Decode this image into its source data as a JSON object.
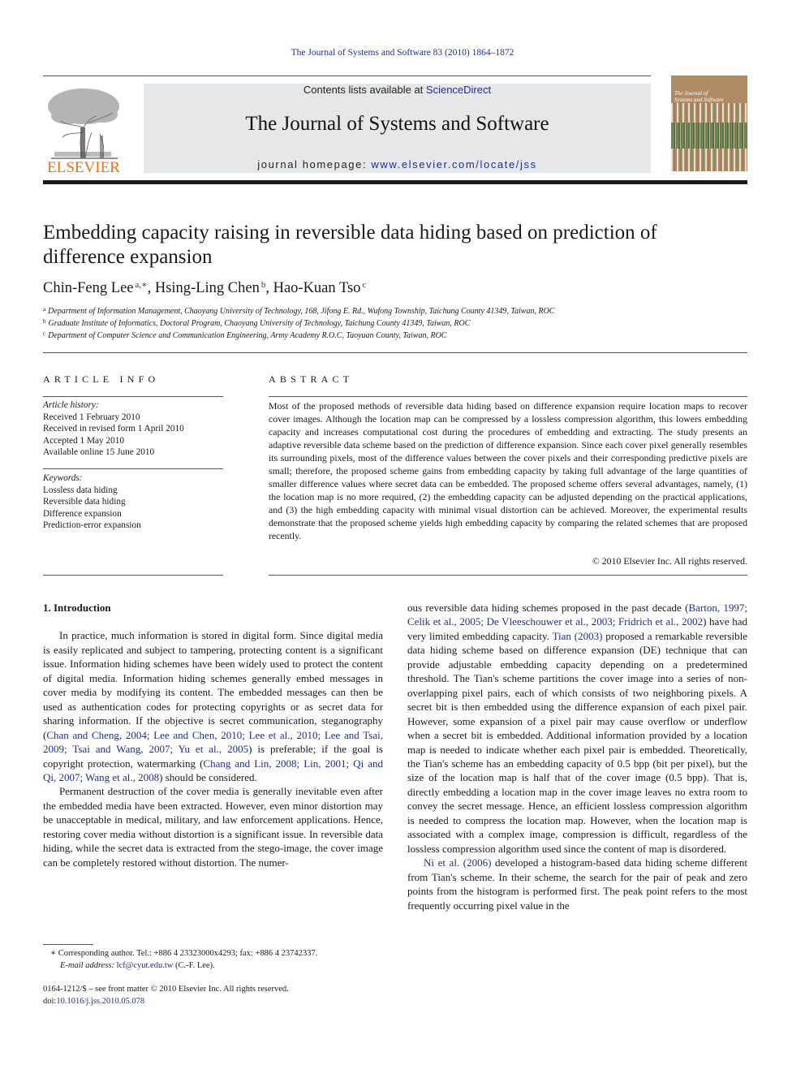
{
  "running_head": "The Journal of Systems and Software 83 (2010) 1864–1872",
  "publisher": {
    "name": "ELSEVIER",
    "brand_color": "#e9711c"
  },
  "masthead": {
    "contents_prefix": "Contents lists available at ",
    "contents_link": "ScienceDirect",
    "journal_title": "The Journal of Systems and Software",
    "homepage_prefix": "journal homepage: ",
    "homepage_link": "www.elsevier.com/locate/jss",
    "link_color": "#1f2f8f",
    "background": "#e6e7e8"
  },
  "cover": {
    "title_line1": "The Journal of",
    "title_line2": "Systems and Software"
  },
  "article": {
    "title": "Embedding capacity raising in reversible data hiding based on prediction of difference expansion",
    "authors": [
      {
        "name": "Chin-Feng Lee",
        "sup": "a,∗"
      },
      {
        "name": "Hsing-Ling Chen",
        "sup": "b"
      },
      {
        "name": "Hao-Kuan Tso",
        "sup": "c"
      }
    ],
    "affiliations": [
      {
        "mark": "a",
        "text": "Department of Information Management, Chaoyang University of Technology, 168, Jifong E. Rd., Wufong Township, Taichung County 41349, Taiwan, ROC"
      },
      {
        "mark": "b",
        "text": "Graduate Institute of Informatics, Doctoral Program, Chaoyang University of Technology, Taichung County 41349, Taiwan, ROC"
      },
      {
        "mark": "c",
        "text": "Department of Computer Science and Communication Engineering, Army Academy R.O.C, Taoyuan County, Taiwan, ROC"
      }
    ]
  },
  "article_info": {
    "heading": "ARTICLE INFO",
    "history_label": "Article history:",
    "history": [
      "Received 1 February 2010",
      "Received in revised form 1 April 2010",
      "Accepted 1 May 2010",
      "Available online 15 June 2010"
    ],
    "keywords_label": "Keywords:",
    "keywords": [
      "Lossless data hiding",
      "Reversible data hiding",
      "Difference expansion",
      "Prediction-error expansion"
    ]
  },
  "abstract": {
    "heading": "ABSTRACT",
    "text": "Most of the proposed methods of reversible data hiding based on difference expansion require location maps to recover cover images. Although the location map can be compressed by a lossless compression algorithm, this lowers embedding capacity and increases computational cost during the procedures of embedding and extracting. The study presents an adaptive reversible data scheme based on the pre­diction of difference expansion. Since each cover pixel generally resembles its surrounding pixels, most of the difference values between the cover pixels and their corresponding predictive pixels are small; therefore, the proposed scheme gains from embedding capacity by taking full advantage of the large quantities of smaller difference values where secret data can be embedded. The proposed scheme offers several advantages, namely, (1) the location map is no more required, (2) the embedding capacity can be adjusted depending on the practical applications, and (3) the high embedding capacity with minimal visual distortion can be achieved. Moreover, the experimental results demonstrate that the proposed scheme yields high embedding capacity by comparing the related schemes that are proposed recently.",
    "copyright": "© 2010 Elsevier Inc. All rights reserved."
  },
  "body": {
    "section_heading": "1.  Introduction",
    "p1_a": "In practice, much information is stored in digital form. Since digital media is easily replicated and subject to tampering, protect­ing content is a significant issue. Information hiding schemes have been widely used to protect the content of digital media. Informa­tion hiding schemes generally embed messages in cover media by modifying its content. The embedded messages can then be used as authentication codes for protecting copyrights or as secret data for sharing information. If the objective is secret communication, steganography (",
    "p1_cite1": "Chan and Cheng, 2004; Lee and Chen, 2010; Lee et al., 2010; Lee and Tsai, 2009; Tsai and Wang, 2007; Yu et al., 2005",
    "p1_b": ") is preferable; if the goal is copyright protection, watermarking (",
    "p1_cite2": "Chang and Lin, 2008; Lin, 2001; Qi and Qi, 2007; Wang et al., 2008",
    "p1_c": ") should be considered.",
    "p2": "Permanent destruction of the cover media is generally inevitable even after the embedded media have been extracted. However, even minor distortion may be unacceptable in medical, military, and law enforcement applications. Hence, restoring cover media without distortion is a significant issue. In reversible data hiding, while the secret data is extracted from the stego-image, the cover image can be completely restored without distortion. The numer­ous reversible data hiding schemes proposed in the past decade (",
    "p2_cite1": "Barton, 1997; Celik et al., 2005; De Vleeschouwer et al., 2003; Fridrich et al., 2002",
    "p2_b": ") have had very limited embedding capacity. ",
    "p2_cite2": "Tian (2003)",
    "p2_c": " proposed a remarkable reversible data hiding scheme based on difference expansion (DE) technique that can provide adjustable embedding capacity depending on a predetermined threshold. The Tian's scheme partitions the cover image into a series of non-overlapping pixel pairs, each of which consists of two neigh­boring pixels. A secret bit is then embedded using the difference expansion of each pixel pair. However, some expansion of a pixel pair may cause overflow or underflow when a secret bit is embed­ded. Additional information provided by a location map is needed to indicate whether each pixel pair is embedded. Theoretically, the Tian's scheme has an embedding capacity of 0.5 bpp (bit per pixel), but the size of the location map is half that of the cover image (0.5 bpp). That is, directly embedding a location map in the cover image leaves no extra room to convey the secret message. Hence, an efficient lossless compression algorithm is needed to compress the location map. However, when the location map is associated with a complex image, compression is difficult, regardless of the lossless compression algorithm used since the content of map is disordered.",
    "p3_cite": "Ni et al. (2006)",
    "p3": " developed a histogram-based data hiding scheme different from Tian's scheme. In their scheme, the search for the pair of peak and zero points from the histogram is performed first. The peak point refers to the most frequently occurring pixel value in the"
  },
  "footnote": {
    "mark": "∗",
    "corresponding": " Corresponding author. Tel.: +886 4 23323000x4293; fax: +886 4 23742337.",
    "email_label": "E-mail address: ",
    "email": "lcf@cyut.edu.tw",
    "email_suffix": " (C.-F. Lee)."
  },
  "front_matter": {
    "issn_line": "0164-1212/$ – see front matter © 2010 Elsevier Inc. All rights reserved.",
    "doi_prefix": "doi:",
    "doi": "10.1016/j.jss.2010.05.078"
  }
}
